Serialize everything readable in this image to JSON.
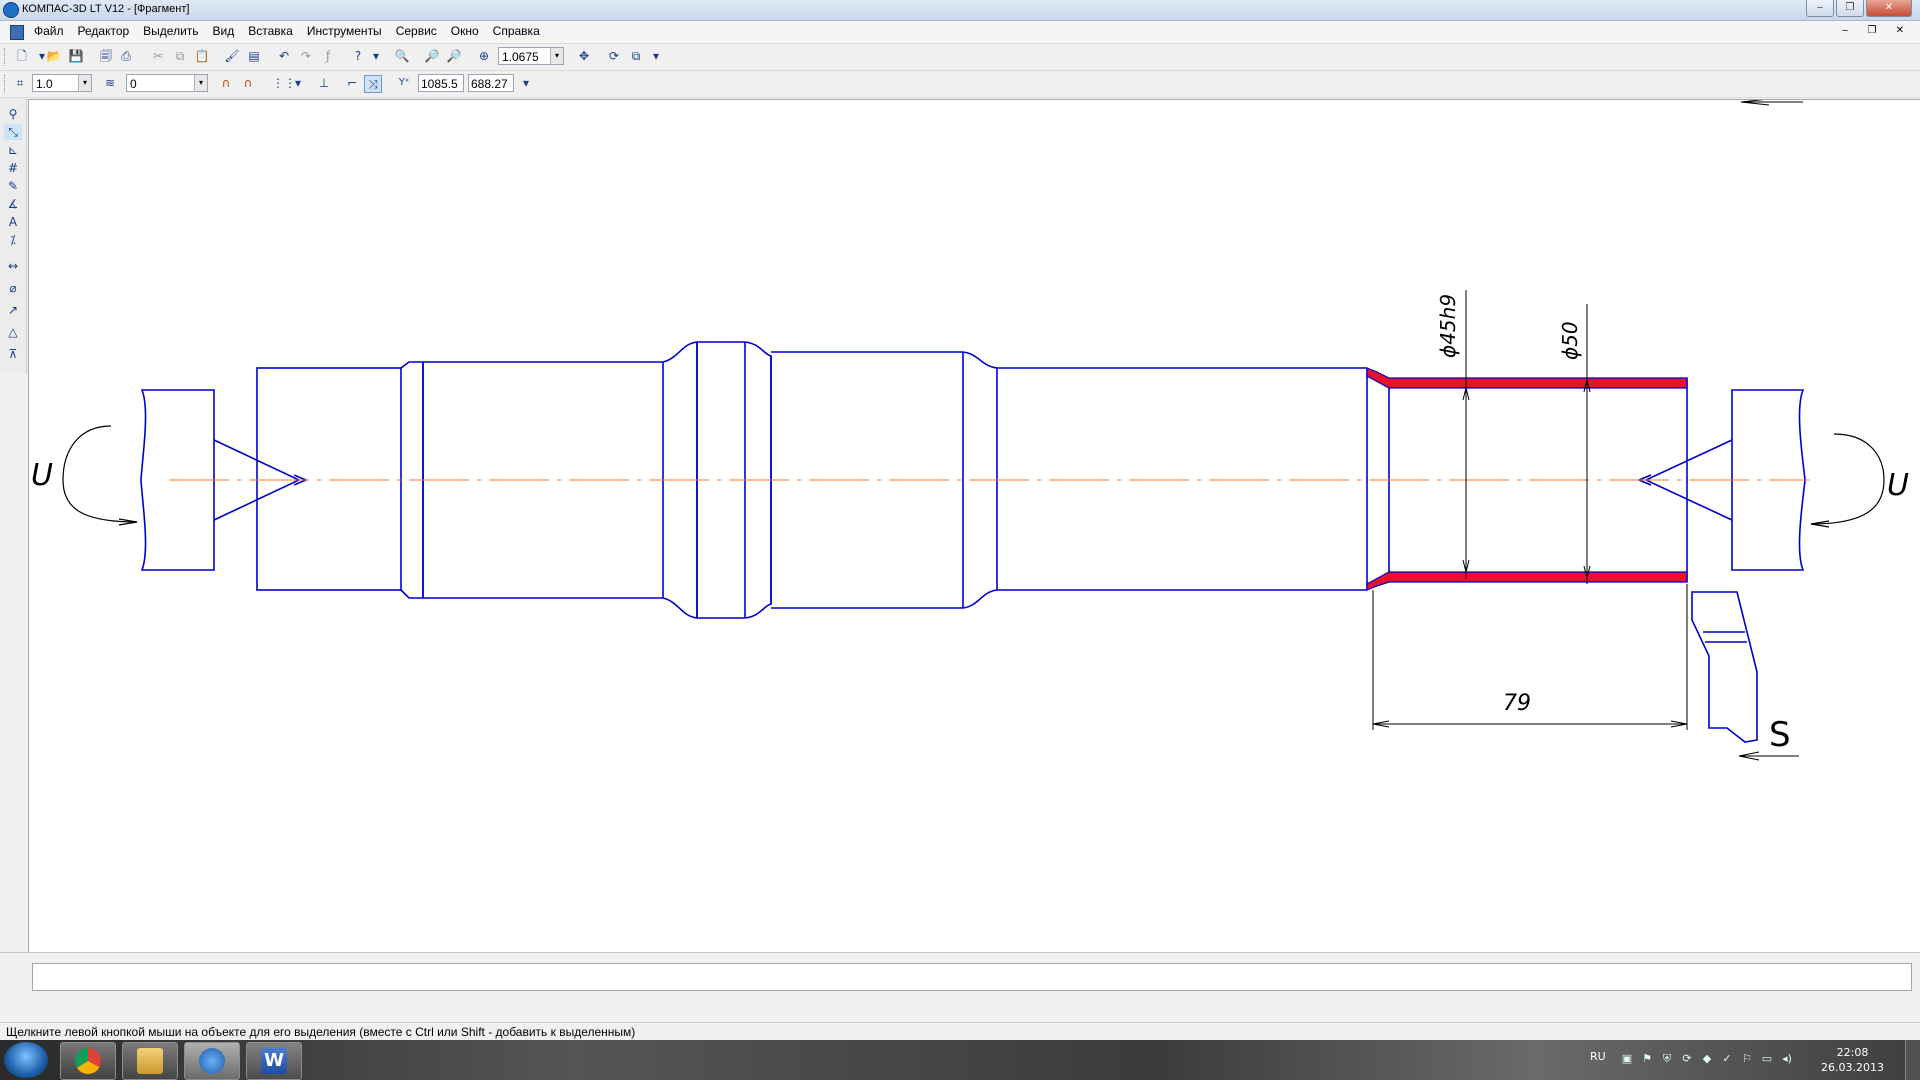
{
  "window": {
    "title": "КОМПАС-3D LT V12 - [Фрагмент]",
    "buttons": [
      "‒",
      "❐",
      "✕"
    ]
  },
  "menu": {
    "items": [
      "Файл",
      "Редактор",
      "Выделить",
      "Вид",
      "Вставка",
      "Инструменты",
      "Сервис",
      "Окно",
      "Справка"
    ],
    "mdi_controls": "‒ ❐ ✕"
  },
  "toolbar_main": {
    "zoom_value": "1.0675"
  },
  "toolbar_current": {
    "step_value": "1.0",
    "layer_value": "0",
    "coord_x": "1085.5",
    "coord_y": "688.27",
    "coord_prefix": "ˣ"
  },
  "drawing": {
    "dim_diameter_1": "ϕ45h9",
    "dim_diameter_2": "ϕ50",
    "dim_length": "79",
    "label_u_left": "U",
    "label_u_right": "U",
    "label_s": "S",
    "colors": {
      "outline": "#0000cc",
      "axis": "#f07820",
      "machined_layer": "#e8102a",
      "dimension": "#000000"
    }
  },
  "statusbar": {
    "message": "Щелкните левой кнопкой мыши на объекте для его выделения (вместе с Ctrl или Shift - добавить к выделенным)"
  },
  "taskbar": {
    "apps": [
      "start-button",
      "chrome",
      "explorer",
      "kompas",
      "word"
    ],
    "language": "RU",
    "time": "22:08",
    "date": "26.03.2013"
  }
}
